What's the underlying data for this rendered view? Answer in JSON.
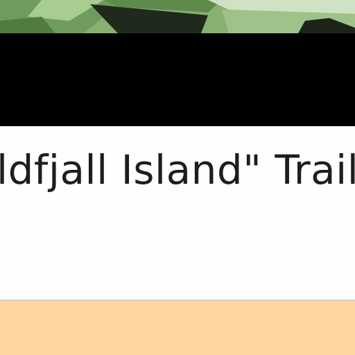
{
  "video": {
    "title": "ldfjall Island\" Traile"
  },
  "colors": {
    "player_background": "#000000",
    "title_text": "#1d1d1d",
    "footer_background": "#ffd59e",
    "thumbnail_green": "#8fb57a"
  }
}
